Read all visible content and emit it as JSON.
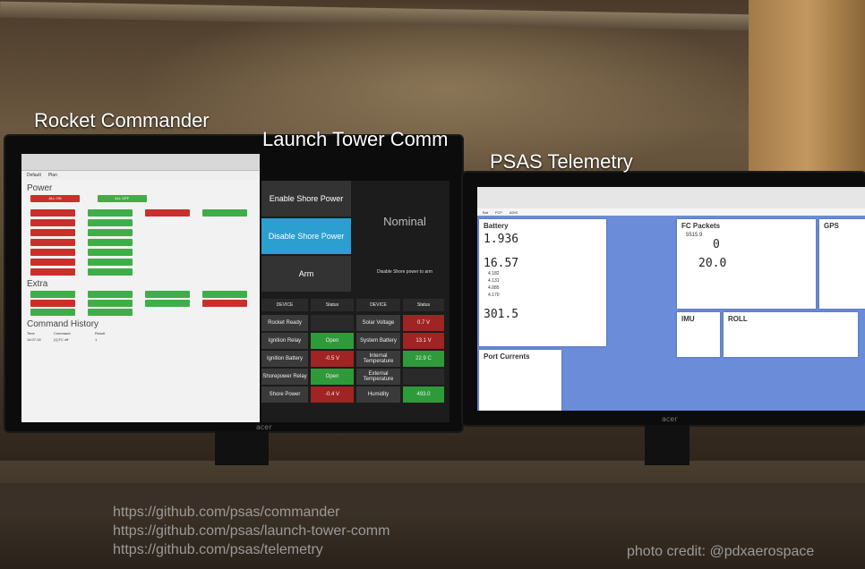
{
  "labels": {
    "commander": "Rocket Commander",
    "launch_tower": "Launch Tower Comm",
    "telemetry": "PSAS Telemetry"
  },
  "links": [
    "https://github.com/psas/commander",
    "https://github.com/psas/launch-tower-comm",
    "https://github.com/psas/telemetry"
  ],
  "credit": "photo credit: @pdxaerospace",
  "brand": "acer",
  "commander_screen": {
    "tabs": [
      "Default",
      "Plan"
    ],
    "power_heading": "Power",
    "all_on": "ALL ON",
    "all_off": "ALL OFF",
    "extra_heading": "Extra",
    "history_heading": "Command History",
    "history_cols": [
      "Time",
      "Command",
      "Result"
    ],
    "history_row": [
      "14:07:18",
      "[1] FC off",
      "1"
    ]
  },
  "launch_tower_screen": {
    "enable_shore": "Enable Shore Power",
    "disable_shore": "Disable Shore Power",
    "arm": "Arm",
    "status_text": "Nominal",
    "disable_note": "Disable Shore power to arm",
    "headers": [
      "DEVICE",
      "Status",
      "DEVICE",
      "Status"
    ],
    "rows": [
      {
        "d1": "Rocket Ready",
        "s1": "",
        "d2": "Solar Voltage",
        "s2": "0.7 V"
      },
      {
        "d1": "Ignition Relay",
        "s1": "Open",
        "d2": "System Battery",
        "s2": "13.1 V"
      },
      {
        "d1": "Ignition Battery",
        "s1": "-0.5 V",
        "d2": "Internal Temperature",
        "s2": "22.9 C"
      },
      {
        "d1": "Shorepower Relay",
        "s1": "Open",
        "d2": "External Temperature",
        "s2": ""
      },
      {
        "d1": "Shore Power",
        "s1": "-0.4 V",
        "d2": "Humidity",
        "s2": "493.0"
      }
    ]
  },
  "telemetry_screen": {
    "battery_title": "Battery",
    "battery_v1": "1.936",
    "battery_v2": "16.57",
    "battery_small": [
      "4.182",
      "4.131",
      "4.085",
      "4.170"
    ],
    "battery_v3": "301.5",
    "port_currents": "Port Currents",
    "fc_packets": "FC Packets",
    "fc_v1": "5515.9",
    "fc_v2": "0",
    "fc_v3": "20.0",
    "gps": "GPS",
    "imu": "IMU",
    "roll": "ROLL"
  },
  "colors": {
    "red": "#c9302c",
    "green": "#3fae49",
    "ltc_blue": "#2a9fd0",
    "tel_blue": "#6b8cd8"
  }
}
